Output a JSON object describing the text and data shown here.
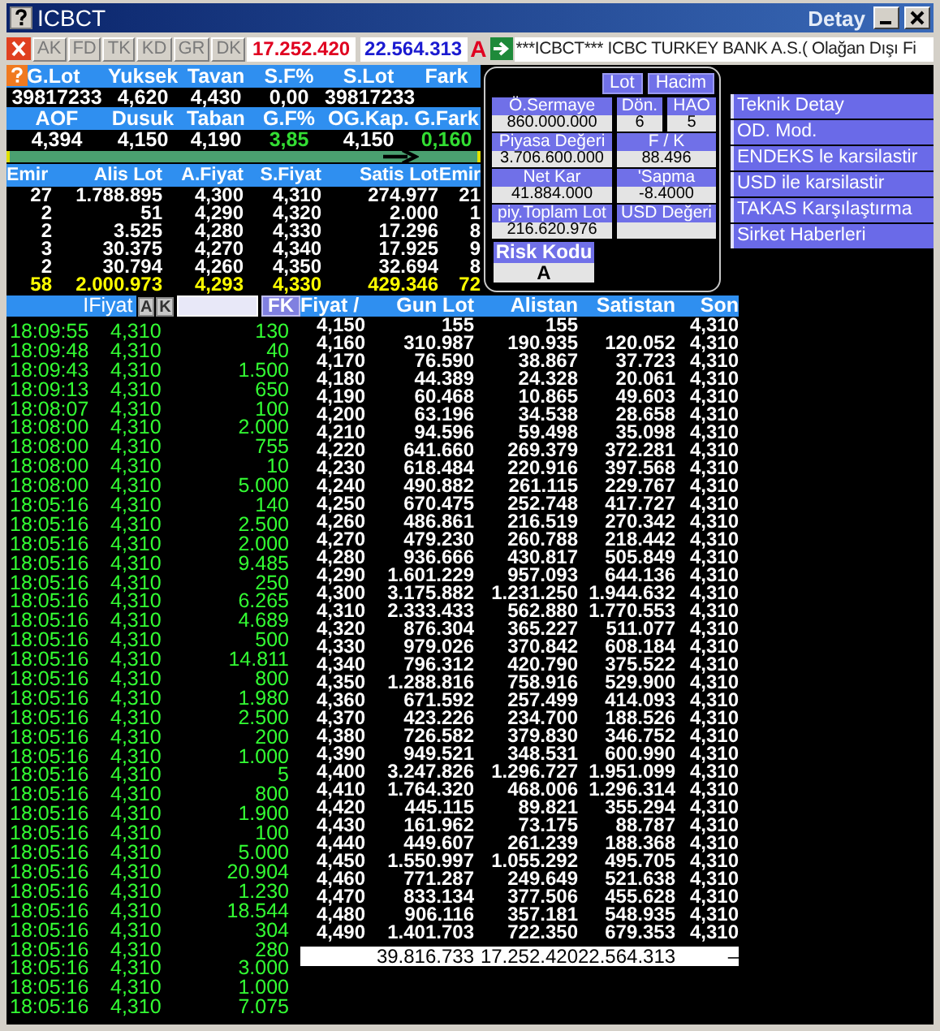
{
  "window": {
    "title": "ICBCT",
    "subtitle": "Detay"
  },
  "toolbar": {
    "buttons": [
      {
        "label": "AK",
        "disabled": true
      },
      {
        "label": "FD",
        "disabled": true
      },
      {
        "label": "TK",
        "disabled": true
      },
      {
        "label": "KD",
        "disabled": true
      },
      {
        "label": "GR",
        "disabled": true
      },
      {
        "label": "DK",
        "disabled": true
      }
    ],
    "bid_total": "17.252.420",
    "ask_total": "22.564.313",
    "flag": "A",
    "ticker": "***ICBCT*** ICBC TURKEY BANK A.S.( Olağan Dışı Fi"
  },
  "stats": [
    [
      {
        "label": "G.Lot",
        "value": "39817233"
      },
      {
        "label": "Yuksek",
        "value": "4,620"
      },
      {
        "label": "Tavan",
        "value": "4,430"
      },
      {
        "label": "S.F%",
        "value": "0,00"
      },
      {
        "label": "S.Lot",
        "value": "39817233"
      },
      {
        "label": "Fark"
      }
    ],
    [
      {
        "label": "AOF",
        "value": "4,394",
        "up": false
      },
      {
        "label": "Dusuk",
        "value": "4,150",
        "up": false
      },
      {
        "label": "Taban",
        "value": "4,190",
        "up": false
      },
      {
        "label": "G.F%",
        "value": "3,85",
        "up": true
      },
      {
        "label": "OG.Kap.",
        "value": "4,150",
        "up": false
      },
      {
        "label": "G.Fark",
        "value": "0,160",
        "up": true
      }
    ]
  ],
  "order_book": {
    "columns": [
      "Emir",
      "Alis Lot",
      "A.Fiyat",
      "S.Fiyat",
      "Satis Lot",
      "Emir"
    ],
    "rows": [
      [
        "27",
        "1.788.895",
        "4,300",
        "4,310",
        "274.977",
        "21"
      ],
      [
        "2",
        "51",
        "4,290",
        "4,320",
        "2.000",
        "1"
      ],
      [
        "2",
        "3.525",
        "4,280",
        "4,330",
        "17.296",
        "8"
      ],
      [
        "3",
        "30.375",
        "4,270",
        "4,340",
        "17.925",
        "9"
      ],
      [
        "2",
        "30.794",
        "4,260",
        "4,350",
        "32.694",
        "8"
      ]
    ],
    "total": [
      "58",
      "2.000.973",
      "4,293",
      "4,330",
      "429.346",
      "72"
    ]
  },
  "info_panel": {
    "toggles": [
      "Lot",
      "Hacim"
    ],
    "fields": [
      {
        "label": "Ö.Sermaye",
        "value": "860.000.000"
      },
      {
        "label": "Dön.",
        "value": "6"
      },
      {
        "label": "HAO",
        "value": "5"
      },
      {
        "label": "Piyasa Değeri",
        "value": "3.706.600.000"
      },
      {
        "label": "F / K",
        "value": "88.496"
      },
      {
        "label": "Net Kar",
        "value": "41.884.000"
      },
      {
        "label": "'Sapma",
        "value": "-8.4000"
      },
      {
        "label": "piy.Toplam Lot",
        "value": "216.620.976"
      },
      {
        "label": "USD Değeri"
      }
    ],
    "risk": {
      "label": "Risk Kodu",
      "value": "A"
    }
  },
  "menu": [
    "Teknik Detay",
    "OD. Mod.",
    "ENDEKS le karsilastir",
    "USD ile karsilastir",
    "TAKAS Karşılaştırma",
    "Sirket Haberleri"
  ],
  "trades": {
    "header": "IFiyat",
    "buttons": [
      "A",
      "K"
    ],
    "filter_button": "FK",
    "rows": [
      {
        "time": "18:09:55",
        "price": "4,310",
        "lot": "130"
      },
      {
        "time": "18:09:48",
        "price": "4,310",
        "lot": "40"
      },
      {
        "time": "18:09:43",
        "price": "4,310",
        "lot": "1.500"
      },
      {
        "time": "18:09:13",
        "price": "4,310",
        "lot": "650"
      },
      {
        "time": "18:08:07",
        "price": "4,310",
        "lot": "100"
      },
      {
        "time": "18:08:00",
        "price": "4,310",
        "lot": "2.000"
      },
      {
        "time": "18:08:00",
        "price": "4,310",
        "lot": "755"
      },
      {
        "time": "18:08:00",
        "price": "4,310",
        "lot": "10"
      },
      {
        "time": "18:08:00",
        "price": "4,310",
        "lot": "5.000"
      },
      {
        "time": "18:05:16",
        "price": "4,310",
        "lot": "140"
      },
      {
        "time": "18:05:16",
        "price": "4,310",
        "lot": "2.500"
      },
      {
        "time": "18:05:16",
        "price": "4,310",
        "lot": "2.000"
      },
      {
        "time": "18:05:16",
        "price": "4,310",
        "lot": "9.485"
      },
      {
        "time": "18:05:16",
        "price": "4,310",
        "lot": "250"
      },
      {
        "time": "18:05:16",
        "price": "4,310",
        "lot": "6.265"
      },
      {
        "time": "18:05:16",
        "price": "4,310",
        "lot": "4.689"
      },
      {
        "time": "18:05:16",
        "price": "4,310",
        "lot": "500"
      },
      {
        "time": "18:05:16",
        "price": "4,310",
        "lot": "14.811"
      },
      {
        "time": "18:05:16",
        "price": "4,310",
        "lot": "800"
      },
      {
        "time": "18:05:16",
        "price": "4,310",
        "lot": "1.980"
      },
      {
        "time": "18:05:16",
        "price": "4,310",
        "lot": "2.500"
      },
      {
        "time": "18:05:16",
        "price": "4,310",
        "lot": "200"
      },
      {
        "time": "18:05:16",
        "price": "4,310",
        "lot": "1.000"
      },
      {
        "time": "18:05:16",
        "price": "4,310",
        "lot": "5"
      },
      {
        "time": "18:05:16",
        "price": "4,310",
        "lot": "800"
      },
      {
        "time": "18:05:16",
        "price": "4,310",
        "lot": "1.900"
      },
      {
        "time": "18:05:16",
        "price": "4,310",
        "lot": "100"
      },
      {
        "time": "18:05:16",
        "price": "4,310",
        "lot": "5.000"
      },
      {
        "time": "18:05:16",
        "price": "4,310",
        "lot": "20.904"
      },
      {
        "time": "18:05:16",
        "price": "4,310",
        "lot": "1.230"
      },
      {
        "time": "18:05:16",
        "price": "4,310",
        "lot": "18.544"
      },
      {
        "time": "18:05:16",
        "price": "4,310",
        "lot": "304"
      },
      {
        "time": "18:05:16",
        "price": "4,310",
        "lot": "280"
      },
      {
        "time": "18:05:16",
        "price": "4,310",
        "lot": "3.000"
      },
      {
        "time": "18:05:16",
        "price": "4,310",
        "lot": "1.000"
      },
      {
        "time": "18:05:16",
        "price": "4,310",
        "lot": "7.075"
      }
    ]
  },
  "price_table": {
    "columns": [
      "Fiyat /",
      "Gun Lot",
      "Alistan",
      "Satistan",
      "Son"
    ],
    "rows": [
      [
        "4,150",
        "155",
        "155",
        "",
        "4,310"
      ],
      [
        "4,160",
        "310.987",
        "190.935",
        "120.052",
        "4,310"
      ],
      [
        "4,170",
        "76.590",
        "38.867",
        "37.723",
        "4,310"
      ],
      [
        "4,180",
        "44.389",
        "24.328",
        "20.061",
        "4,310"
      ],
      [
        "4,190",
        "60.468",
        "10.865",
        "49.603",
        "4,310"
      ],
      [
        "4,200",
        "63.196",
        "34.538",
        "28.658",
        "4,310"
      ],
      [
        "4,210",
        "94.596",
        "59.498",
        "35.098",
        "4,310"
      ],
      [
        "4,220",
        "641.660",
        "269.379",
        "372.281",
        "4,310"
      ],
      [
        "4,230",
        "618.484",
        "220.916",
        "397.568",
        "4,310"
      ],
      [
        "4,240",
        "490.882",
        "261.115",
        "229.767",
        "4,310"
      ],
      [
        "4,250",
        "670.475",
        "252.748",
        "417.727",
        "4,310"
      ],
      [
        "4,260",
        "486.861",
        "216.519",
        "270.342",
        "4,310"
      ],
      [
        "4,270",
        "479.230",
        "260.788",
        "218.442",
        "4,310"
      ],
      [
        "4,280",
        "936.666",
        "430.817",
        "505.849",
        "4,310"
      ],
      [
        "4,290",
        "1.601.229",
        "957.093",
        "644.136",
        "4,310"
      ],
      [
        "4,300",
        "3.175.882",
        "1.231.250",
        "1.944.632",
        "4,310"
      ],
      [
        "4,310",
        "2.333.433",
        "562.880",
        "1.770.553",
        "4,310"
      ],
      [
        "4,320",
        "876.304",
        "365.227",
        "511.077",
        "4,310"
      ],
      [
        "4,330",
        "979.026",
        "370.842",
        "608.184",
        "4,310"
      ],
      [
        "4,340",
        "796.312",
        "420.790",
        "375.522",
        "4,310"
      ],
      [
        "4,350",
        "1.288.816",
        "758.916",
        "529.900",
        "4,310"
      ],
      [
        "4,360",
        "671.592",
        "257.499",
        "414.093",
        "4,310"
      ],
      [
        "4,370",
        "423.226",
        "234.700",
        "188.526",
        "4,310"
      ],
      [
        "4,380",
        "726.582",
        "379.830",
        "346.752",
        "4,310"
      ],
      [
        "4,390",
        "949.521",
        "348.531",
        "600.990",
        "4,310"
      ],
      [
        "4,400",
        "3.247.826",
        "1.296.727",
        "1.951.099",
        "4,310"
      ],
      [
        "4,410",
        "1.764.320",
        "468.006",
        "1.296.314",
        "4,310"
      ],
      [
        "4,420",
        "445.115",
        "89.821",
        "355.294",
        "4,310"
      ],
      [
        "4,430",
        "161.962",
        "73.175",
        "88.787",
        "4,310"
      ],
      [
        "4,440",
        "449.607",
        "261.239",
        "188.368",
        "4,310"
      ],
      [
        "4,450",
        "1.550.997",
        "1.055.292",
        "495.705",
        "4,310"
      ],
      [
        "4,460",
        "771.287",
        "249.649",
        "521.638",
        "4,310"
      ],
      [
        "4,470",
        "833.134",
        "377.506",
        "455.628",
        "4,310"
      ],
      [
        "4,480",
        "906.116",
        "357.181",
        "548.935",
        "4,310"
      ],
      [
        "4,490",
        "1.401.703",
        "722.350",
        "679.353",
        "4,310"
      ]
    ],
    "total": [
      "39.816.733",
      "17.252.420",
      "22.564.313",
      "–"
    ]
  }
}
